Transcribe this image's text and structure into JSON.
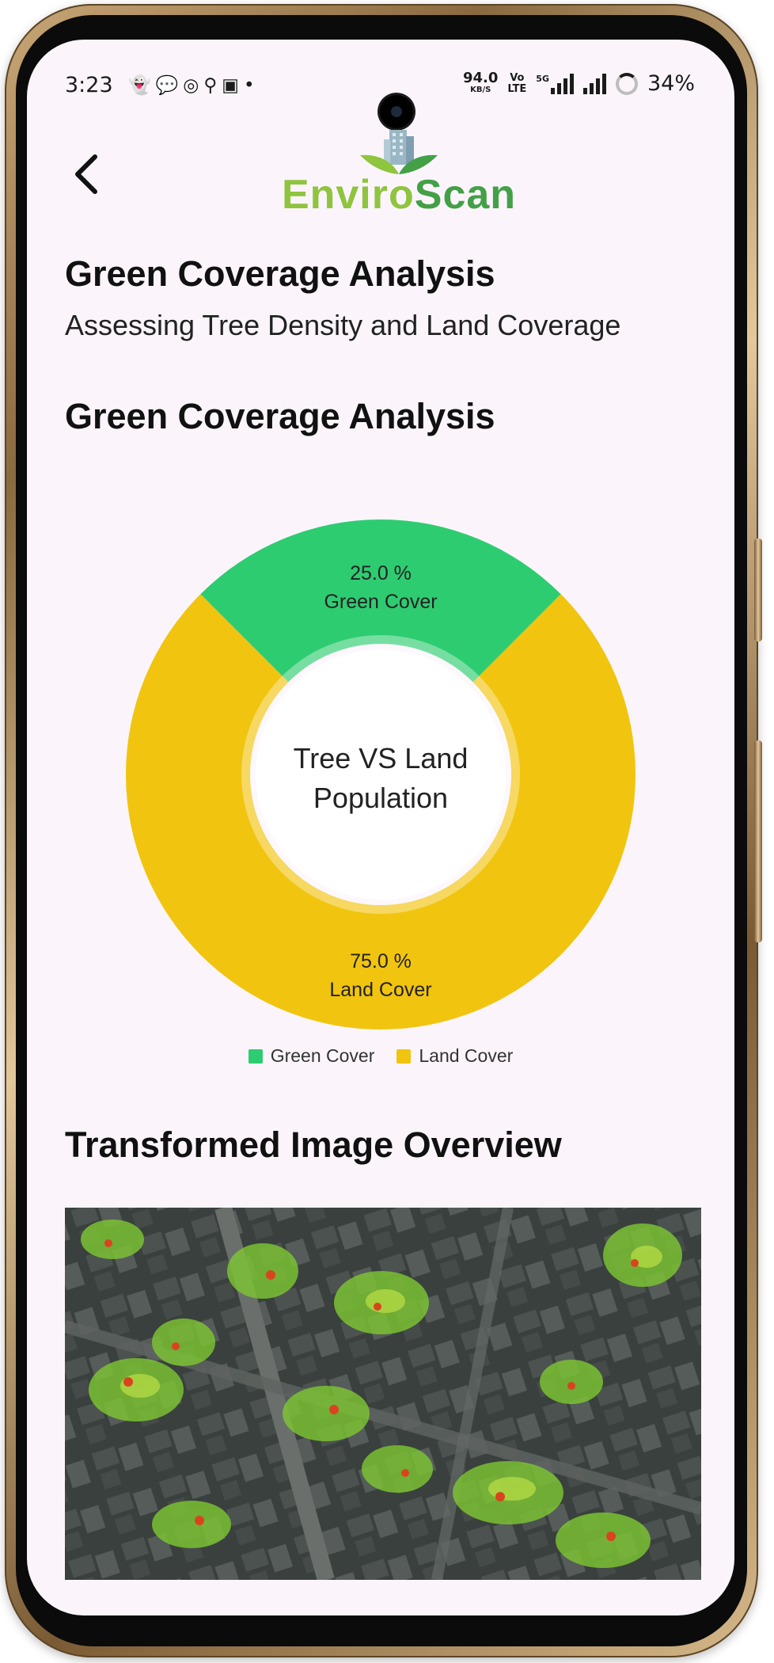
{
  "status_bar": {
    "time": "3:23",
    "notification_icons": [
      "snapchat-icon",
      "chat-icon",
      "whatsapp-icon",
      "location-icon",
      "cast-icon",
      "dot-icon"
    ],
    "net_speed": "94.0",
    "net_speed_unit": "KB/S",
    "volte_top": "Vo",
    "volte_bottom": "LTE",
    "network": "5G",
    "battery": "34%"
  },
  "header": {
    "back_icon": "chevron-left-icon",
    "logo_part1": "Enviro",
    "logo_part2": "Scan",
    "logo_icon": "building-leaves-icon"
  },
  "page": {
    "title": "Green Coverage Analysis",
    "subtitle": "Assessing Tree Density and Land Coverage",
    "chart_heading": "Green Coverage Analysis",
    "image_heading": "Transformed Image Overview"
  },
  "chart_data": {
    "type": "pie",
    "center_label": [
      "Tree VS Land",
      "Population"
    ],
    "slices": [
      {
        "name": "Green Cover",
        "value": 25.0,
        "label": "25.0 %",
        "color": "#2ecc71"
      },
      {
        "name": "Land Cover",
        "value": 75.0,
        "label": "75.0 %",
        "color": "#f1c40f"
      }
    ],
    "legend_position": "bottom"
  },
  "colors": {
    "background": "#fbf5fb",
    "green": "#2ecc71",
    "yellow": "#f1c40f",
    "logo_light": "#8fc43f",
    "logo_dark": "#43a047"
  }
}
